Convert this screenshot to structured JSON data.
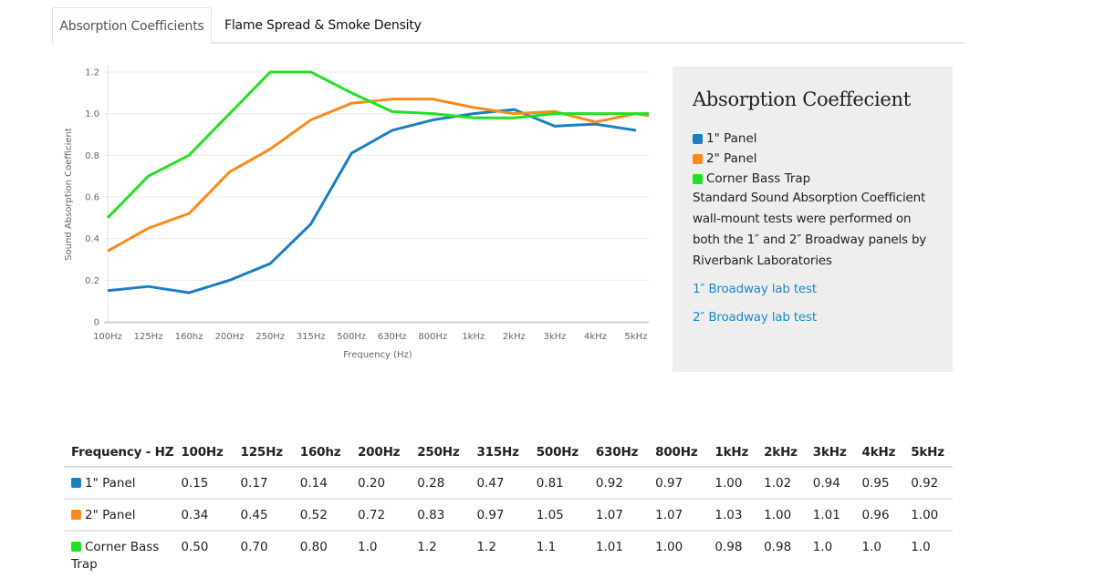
{
  "tabs": [
    {
      "label": "Absorption Coefficients",
      "active": true
    },
    {
      "label": "Flame Spread & Smoke Density",
      "active": false
    }
  ],
  "panel": {
    "title": "Absorption Coeffecient",
    "legend": [
      {
        "label": "1\" Panel",
        "color": "#1a7fc1"
      },
      {
        "label": "2\" Panel",
        "color": "#f98a1c"
      },
      {
        "label": "Corner Bass Trap",
        "color": "#22e022"
      }
    ],
    "description": "Standard Sound Absorption Coefficient wall-mount tests were performed on both the 1″ and 2″ Broadway panels by Riverbank Laboratories",
    "links": [
      {
        "label": "1″ Broadway lab test"
      },
      {
        "label": "2″ Broadway lab test"
      }
    ]
  },
  "chart_data": {
    "type": "line",
    "title": "",
    "xlabel": "Frequency (Hz)",
    "ylabel": "Sound Absorption Coefficient",
    "categories": [
      "100Hz",
      "125Hz",
      "160hz",
      "200Hz",
      "250Hz",
      "315Hz",
      "500Hz",
      "630Hz",
      "800Hz",
      "1kHz",
      "2kHz",
      "3kHz",
      "4kHz",
      "5kHz"
    ],
    "ylim": [
      0,
      1.2
    ],
    "yticks": [
      "0",
      "0.2",
      "0.4",
      "0.6",
      "0.8",
      "1.0",
      "1.2"
    ],
    "ytick_values": [
      0,
      0.2,
      0.4,
      0.6,
      0.8,
      1.0,
      1.2
    ],
    "grid": true,
    "legend_placement": "right",
    "series": [
      {
        "name": "1\" Panel",
        "color": "#1a7fc1",
        "values": [
          0.15,
          0.17,
          0.14,
          0.2,
          0.28,
          0.47,
          0.81,
          0.92,
          0.97,
          1.0,
          1.02,
          0.94,
          0.95,
          0.92
        ]
      },
      {
        "name": "2\" Panel",
        "color": "#f98a1c",
        "values": [
          0.34,
          0.45,
          0.52,
          0.72,
          0.83,
          0.97,
          1.05,
          1.07,
          1.07,
          1.03,
          1.0,
          1.01,
          0.96,
          1.0
        ],
        "trailing_value": 0.99
      },
      {
        "name": "Corner Bass Trap",
        "color": "#22e022",
        "values": [
          0.5,
          0.7,
          0.8,
          1.0,
          1.2,
          1.2,
          1.1,
          1.01,
          1.0,
          0.98,
          0.98,
          1.0,
          1.0,
          1.0
        ],
        "trailing_value": 1.0
      }
    ]
  },
  "table": {
    "header_label": "Frequency - HZ",
    "columns": [
      "100Hz",
      "125Hz",
      "160hz",
      "200Hz",
      "250Hz",
      "315Hz",
      "500Hz",
      "630Hz",
      "800Hz",
      "1kHz",
      "2kHz",
      "3kHz",
      "4kHz",
      "5kHz"
    ],
    "rows": [
      {
        "label": "1\" Panel",
        "color": "#1a7fc1",
        "cells": [
          "0.15",
          "0.17",
          "0.14",
          "0.20",
          "0.28",
          "0.47",
          "0.81",
          "0.92",
          "0.97",
          "1.00",
          "1.02",
          "0.94",
          "0.95",
          "0.92"
        ]
      },
      {
        "label": "2\" Panel",
        "color": "#f98a1c",
        "cells": [
          "0.34",
          "0.45",
          "0.52",
          "0.72",
          "0.83",
          "0.97",
          "1.05",
          "1.07",
          "1.07",
          "1.03",
          "1.00",
          "1.01",
          "0.96",
          "1.00"
        ]
      },
      {
        "label": "Corner Bass Trap",
        "color": "#22e022",
        "cells": [
          "0.50",
          "0.70",
          "0.80",
          "1.0",
          "1.2",
          "1.2",
          "1.1",
          "1.01",
          "1.00",
          "0.98",
          "0.98",
          "1.0",
          "1.0",
          "1.0"
        ]
      }
    ]
  }
}
